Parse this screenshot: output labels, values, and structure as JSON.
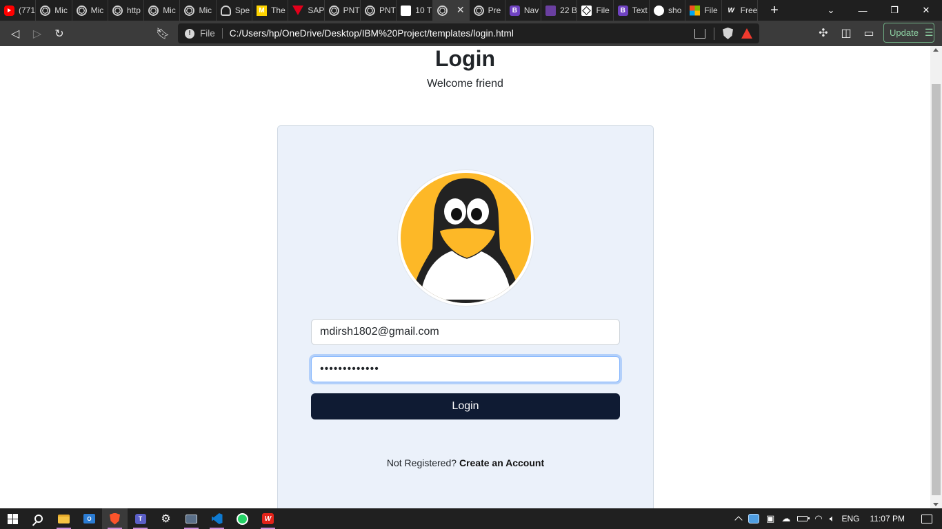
{
  "browser": {
    "tabs": [
      {
        "label": "(771",
        "icon": "youtube-icon"
      },
      {
        "label": "Mic",
        "icon": "globe-icon"
      },
      {
        "label": "Mic",
        "icon": "globe-icon"
      },
      {
        "label": "http",
        "icon": "globe-icon"
      },
      {
        "label": "Mic",
        "icon": "globe-icon"
      },
      {
        "label": "Mic",
        "icon": "globe-icon"
      },
      {
        "label": "Spe",
        "icon": "speedometer-icon"
      },
      {
        "label": "The",
        "icon": "m-logo-icon"
      },
      {
        "label": "SAP",
        "icon": "v-logo-icon"
      },
      {
        "label": "PNT",
        "icon": "globe-icon"
      },
      {
        "label": "PNT",
        "icon": "globe-icon"
      },
      {
        "label": "10 T",
        "icon": "f-logo-icon"
      },
      {
        "label": "",
        "icon": "globe-icon",
        "active": true
      },
      {
        "label": "Pre",
        "icon": "globe-icon"
      },
      {
        "label": "Nav",
        "icon": "bootstrap-icon"
      },
      {
        "label": "22 B",
        "icon": "colorlib-icon"
      },
      {
        "label": "File",
        "icon": "codepen-icon"
      },
      {
        "label": "Text",
        "icon": "bootstrap-icon"
      },
      {
        "label": "sho",
        "icon": "google-icon"
      },
      {
        "label": "File",
        "icon": "microsoft-icon"
      },
      {
        "label": "Free",
        "icon": "wps-icon"
      }
    ],
    "scheme": "File",
    "url": "C:/Users/hp/OneDrive/Desktop/IBM%20Project/templates/login.html",
    "update_label": "Update"
  },
  "page": {
    "title": "Login",
    "subtitle": "Welcome friend",
    "email_value": "mdirsh1802@gmail.com",
    "password_value": "•••••••••••••",
    "login_button": "Login",
    "signup_prompt": "Not Registered?",
    "signup_link": "Create an Account"
  },
  "taskbar": {
    "apps": [
      "start-icon",
      "search-icon",
      "file-explorer-icon",
      "outlook-icon",
      "brave-icon",
      "teams-icon",
      "settings-icon",
      "photos-icon",
      "vscode-icon",
      "whatsapp-icon",
      "wps-icon"
    ],
    "language": "ENG",
    "time": "11:07 PM"
  },
  "colors": {
    "accent": "#0f1b33",
    "card_bg": "#ebf1fa",
    "avatar_bg": "#fdb827",
    "focus_ring": "#86b7fe"
  }
}
